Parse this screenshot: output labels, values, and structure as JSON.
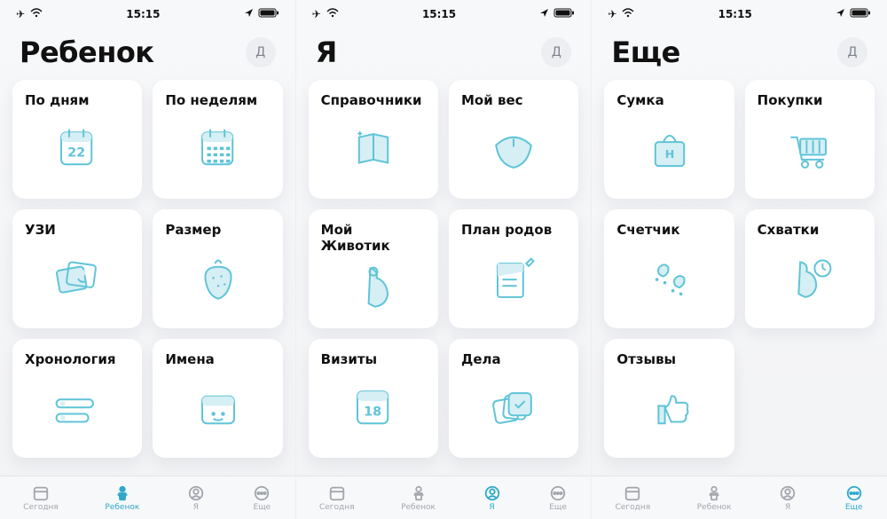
{
  "status_time": "15:15",
  "avatar_initial": "Д",
  "screens": [
    {
      "key": "child",
      "title": "Ребенок",
      "active_tab": 1,
      "cards": [
        {
          "label": "По дням",
          "icon": "calendar-day",
          "icon_text": "22"
        },
        {
          "label": "По неделям",
          "icon": "calendar-week"
        },
        {
          "label": "УЗИ",
          "icon": "ultrasound"
        },
        {
          "label": "Размер",
          "icon": "strawberry"
        },
        {
          "label": "Хронология",
          "icon": "timeline"
        },
        {
          "label": "Имена",
          "icon": "names"
        }
      ]
    },
    {
      "key": "me",
      "title": "Я",
      "active_tab": 2,
      "cards": [
        {
          "label": "Справочники",
          "icon": "book"
        },
        {
          "label": "Мой вес",
          "icon": "scale"
        },
        {
          "label": "Мой Животик",
          "icon": "belly"
        },
        {
          "label": "План родов",
          "icon": "plan"
        },
        {
          "label": "Визиты",
          "icon": "visits",
          "icon_text": "18"
        },
        {
          "label": "Дела",
          "icon": "todo"
        }
      ]
    },
    {
      "key": "more",
      "title": "Еще",
      "active_tab": 3,
      "cards": [
        {
          "label": "Сумка",
          "icon": "bag",
          "icon_text": "H"
        },
        {
          "label": "Покупки",
          "icon": "cart"
        },
        {
          "label": "Счетчик",
          "icon": "counter"
        },
        {
          "label": "Схватки",
          "icon": "contractions"
        },
        {
          "label": "Отзывы",
          "icon": "thumbsup"
        }
      ]
    }
  ],
  "tabs": [
    {
      "label": "Сегодня",
      "icon": "today"
    },
    {
      "label": "Ребенок",
      "icon": "baby"
    },
    {
      "label": "Я",
      "icon": "me"
    },
    {
      "label": "Еще",
      "icon": "more"
    }
  ]
}
